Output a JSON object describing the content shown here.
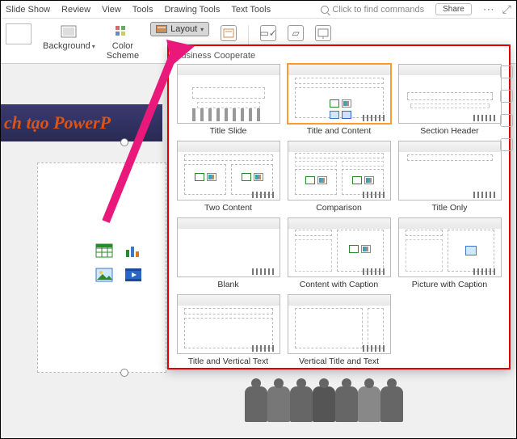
{
  "menu": {
    "items": [
      "Slide Show",
      "Review",
      "View",
      "Tools",
      "Drawing Tools",
      "Text Tools"
    ],
    "search_placeholder": "Click to find commands",
    "share": "Share"
  },
  "ribbon": {
    "background": "Background",
    "color_scheme": "Color\nScheme",
    "layout": "Layout"
  },
  "popup": {
    "theme": "Business Cooperate",
    "layouts": [
      "Title Slide",
      "Title and Content",
      "Section Header",
      "Two Content",
      "Comparison",
      "Title Only",
      "Blank",
      "Content with Caption",
      "Picture with Caption",
      "Title and Vertical Text",
      "Vertical Title and Text"
    ],
    "selected_index": 1
  },
  "slide": {
    "title_text": "ch tạo PowerP"
  }
}
